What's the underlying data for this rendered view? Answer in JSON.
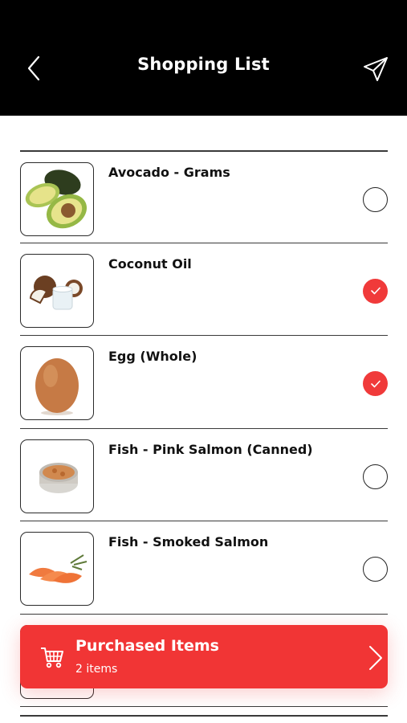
{
  "header": {
    "title": "Shopping List"
  },
  "items": [
    {
      "name": "Avocado - Grams",
      "checked": false,
      "icon": "avocado-image"
    },
    {
      "name": "Coconut Oil",
      "checked": true,
      "icon": "coconut-oil-image"
    },
    {
      "name": "Egg (Whole)",
      "checked": true,
      "icon": "egg-image"
    },
    {
      "name": "Fish - Pink Salmon (Canned)",
      "checked": false,
      "icon": "canned-salmon-image"
    },
    {
      "name": "Fish - Smoked Salmon",
      "checked": false,
      "icon": "smoked-salmon-image"
    }
  ],
  "purchased": {
    "label": "Purchased Items",
    "count": "2 items"
  },
  "colors": {
    "accent": "#f13535",
    "header_bg": "#000000"
  }
}
